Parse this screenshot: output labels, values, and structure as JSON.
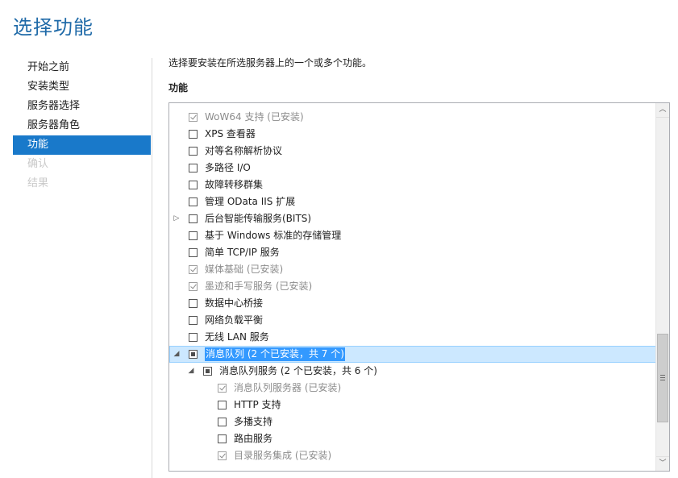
{
  "window": {
    "title": "选择功能"
  },
  "nav": {
    "items": [
      {
        "label": "开始之前",
        "state": "normal"
      },
      {
        "label": "安装类型",
        "state": "normal"
      },
      {
        "label": "服务器选择",
        "state": "normal"
      },
      {
        "label": "服务器角色",
        "state": "normal"
      },
      {
        "label": "功能",
        "state": "active"
      },
      {
        "label": "确认",
        "state": "disabled"
      },
      {
        "label": "结果",
        "state": "disabled"
      }
    ]
  },
  "main": {
    "description": "选择要安装在所选服务器上的一个或多个功能。",
    "heading": "功能",
    "features": [
      {
        "label": "WoW64 支持 (已安装)",
        "level": 0,
        "check": "checked",
        "installed": true,
        "expander": ""
      },
      {
        "label": "XPS 查看器",
        "level": 0,
        "check": "unchecked",
        "installed": false,
        "expander": ""
      },
      {
        "label": "对等名称解析协议",
        "level": 0,
        "check": "unchecked",
        "installed": false,
        "expander": ""
      },
      {
        "label": "多路径 I/O",
        "level": 0,
        "check": "unchecked",
        "installed": false,
        "expander": ""
      },
      {
        "label": "故障转移群集",
        "level": 0,
        "check": "unchecked",
        "installed": false,
        "expander": ""
      },
      {
        "label": "管理 OData IIS 扩展",
        "level": 0,
        "check": "unchecked",
        "installed": false,
        "expander": ""
      },
      {
        "label": "后台智能传输服务(BITS)",
        "level": 0,
        "check": "unchecked",
        "installed": false,
        "expander": "collapsed"
      },
      {
        "label": "基于 Windows 标准的存储管理",
        "level": 0,
        "check": "unchecked",
        "installed": false,
        "expander": ""
      },
      {
        "label": "简单 TCP/IP 服务",
        "level": 0,
        "check": "unchecked",
        "installed": false,
        "expander": ""
      },
      {
        "label": "媒体基础 (已安装)",
        "level": 0,
        "check": "checked",
        "installed": true,
        "expander": ""
      },
      {
        "label": "墨迹和手写服务 (已安装)",
        "level": 0,
        "check": "checked",
        "installed": true,
        "expander": ""
      },
      {
        "label": "数据中心桥接",
        "level": 0,
        "check": "unchecked",
        "installed": false,
        "expander": ""
      },
      {
        "label": "网络负载平衡",
        "level": 0,
        "check": "unchecked",
        "installed": false,
        "expander": ""
      },
      {
        "label": "无线 LAN 服务",
        "level": 0,
        "check": "unchecked",
        "installed": false,
        "expander": ""
      },
      {
        "label": "消息队列 (2 个已安装，共 7 个)",
        "level": 0,
        "check": "partial",
        "installed": false,
        "expander": "expanded",
        "selected": true
      },
      {
        "label": "消息队列服务 (2 个已安装，共 6 个)",
        "level": 1,
        "check": "partial",
        "installed": false,
        "expander": "expanded"
      },
      {
        "label": "消息队列服务器 (已安装)",
        "level": 2,
        "check": "checked",
        "installed": true,
        "expander": ""
      },
      {
        "label": "HTTP 支持",
        "level": 2,
        "check": "unchecked",
        "installed": false,
        "expander": ""
      },
      {
        "label": "多播支持",
        "level": 2,
        "check": "unchecked",
        "installed": false,
        "expander": ""
      },
      {
        "label": "路由服务",
        "level": 2,
        "check": "unchecked",
        "installed": false,
        "expander": ""
      },
      {
        "label": "目录服务集成 (已安装)",
        "level": 2,
        "check": "checked",
        "installed": true,
        "expander": ""
      }
    ]
  },
  "icons": {
    "expander_collapsed": "▷",
    "expander_expanded": "◢",
    "scroll_up": "︿",
    "scroll_down": "﹀"
  },
  "colors": {
    "title": "#1f6aa8",
    "nav_active_bg": "#1979ca",
    "selection_bg": "#3399ff",
    "installed_text": "#8c8c8c"
  }
}
